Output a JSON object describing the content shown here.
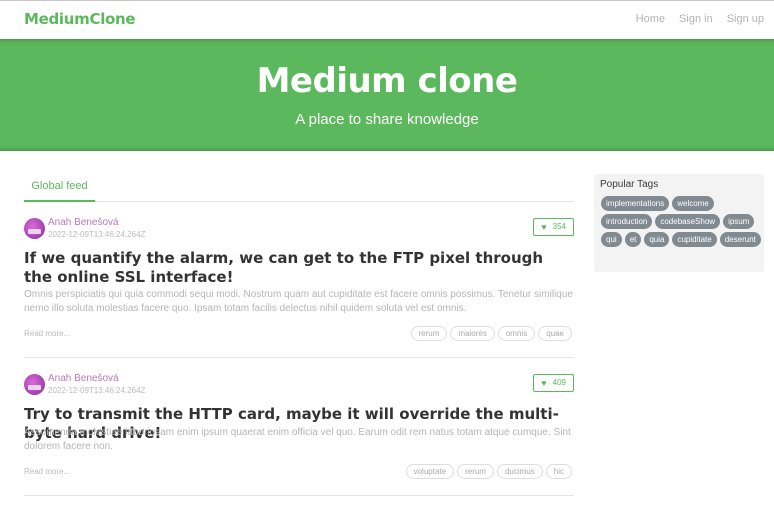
{
  "navbar": {
    "brand": "MediumClone",
    "links": [
      "Home",
      "Sign in",
      "Sign up"
    ]
  },
  "banner": {
    "title": "Medium clone",
    "subtitle": "A place to share knowledge"
  },
  "feed": {
    "tab": "Global feed",
    "articles": [
      {
        "author": "Anah Benešová",
        "date": "2022-12-09T13:46:24.264Z",
        "likes": "354",
        "title": "If we quantify the alarm, we can get to the FTP pixel through the online SSL interface!",
        "description": "Omnis perspiciatis qui quia commodi sequi modi. Nostrum quam aut cupiditate est facere omnis possimus. Tenetur similique nemo illo soluta molestias facere quo. Ipsam totam facilis delectus nihil quidem soluta vel est omnis.",
        "read_more": "Read more...",
        "tags": [
          "rerum",
          "maiores",
          "omnis",
          "quae"
        ]
      },
      {
        "author": "Anah Benešová",
        "date": "2022-12-09T13:46:24.264Z",
        "likes": "409",
        "title": "Try to transmit the HTTP card, maybe it will override the multi-byte hard drive!",
        "description": "Assumenda molestiae laboriosam enim ipsum quaerat enim officia vel quo. Earum odit rem natus totam atque cumque. Sint dolorem facere non.",
        "read_more": "Read more...",
        "tags": [
          "voluptate",
          "rerum",
          "ducimus",
          "hic"
        ]
      }
    ]
  },
  "sidebar": {
    "title": "Popular Tags",
    "tags": [
      "implementations",
      "welcome",
      "introduction",
      "codebaseShow",
      "ipsum",
      "qui",
      "et",
      "quia",
      "cupiditate",
      "deserunt"
    ]
  },
  "icons": {
    "like": "heart-icon"
  },
  "colors": {
    "accent": "#5cb85c",
    "author": "#bb79bf",
    "tag_pill": "#818a91"
  }
}
